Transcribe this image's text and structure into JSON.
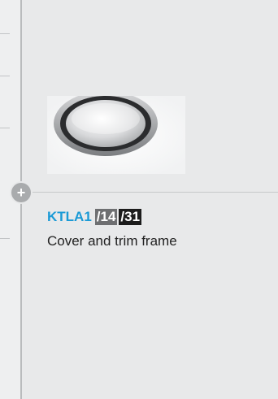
{
  "product": {
    "code": "KTLA1",
    "variants": [
      "/14",
      "/31"
    ],
    "description": "Cover and trim frame",
    "image_icon": "round-cover-trim-frame"
  },
  "controls": {
    "expand_icon": "plus-icon",
    "expand_symbol": "+"
  },
  "colors": {
    "accent": "#1a9ad6",
    "badge_grey": "#6e6f71",
    "badge_black": "#1c1c1c",
    "background": "#e8e9ea"
  }
}
